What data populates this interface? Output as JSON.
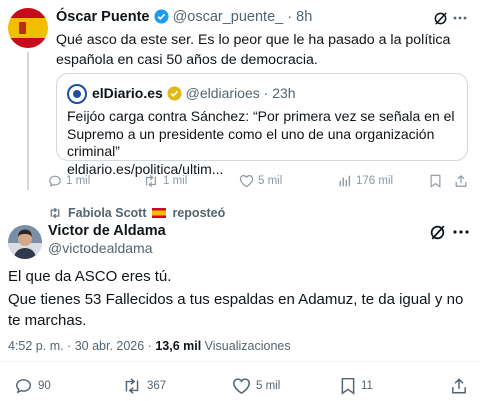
{
  "parent": {
    "name": "Óscar Puente",
    "handle": "@oscar_puente_",
    "time": "8h",
    "text": "Qué asco da este ser. Es lo peor que le ha pasado a la política española en casi 50 años de democracia.",
    "quote": {
      "name": "elDiario.es",
      "handle": "@eldiarioes",
      "time": "23h",
      "text": "Feijóo carga contra Sánchez: “Por primera vez se señala en el Supremo a un presidente como el uno de una organización criminal”",
      "link": "eldiario.es/politica/ultim..."
    },
    "actions": {
      "replies": "1 mil",
      "reposts": "1 mil",
      "likes": "5 mil",
      "views": "176 mil"
    }
  },
  "repost_banner": {
    "user": "Fabiola Scott",
    "suffix": "reposteó"
  },
  "main": {
    "name": "Victor de Aldama",
    "handle": "@victodealdama",
    "text_line1": "El que da ASCO eres tú.",
    "text_line2": "Que tienes 53 Fallecidos a tus espaldas en Adamuz, te da igual y no te marchas.",
    "timestamp": "4:52 p. m. · 30 abr. 2026 · ",
    "views_count": "13,6 mil",
    "views_label": "Visualizaciones",
    "actions": {
      "replies": "90",
      "reposts": "367",
      "likes": "5 mil",
      "bookmarks": "11"
    }
  },
  "colors": {
    "text": "#0f1419",
    "muted": "#536471",
    "border": "#cfd9de",
    "verified": "#1d9bf0"
  }
}
